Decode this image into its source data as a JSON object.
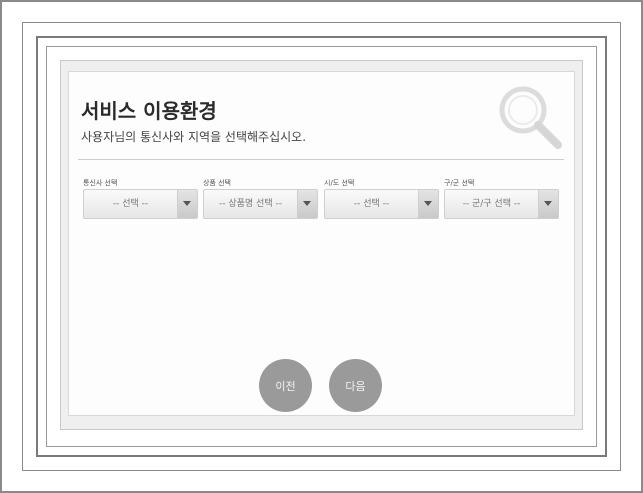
{
  "page": {
    "title": "서비스 이용환경",
    "subtitle": "사용자님의 통신사와 지역을 선택해주십시오."
  },
  "selects": [
    {
      "label": "통신사 선택",
      "value": "-- 선택 --"
    },
    {
      "label": "상품 선택",
      "value": "-- 상품명 선택 --"
    },
    {
      "label": "시/도 선택",
      "value": "-- 선택 --"
    },
    {
      "label": "구/군 선택",
      "value": "-- 군/구 선택 --"
    }
  ],
  "buttons": {
    "prev": "이전",
    "next": "다음"
  },
  "icons": {
    "header": "search-icon",
    "dropdown": "chevron-down-icon"
  },
  "colors": {
    "button": "#9a9a9a",
    "card": "#fdfdfd",
    "panel": "#efefef"
  }
}
